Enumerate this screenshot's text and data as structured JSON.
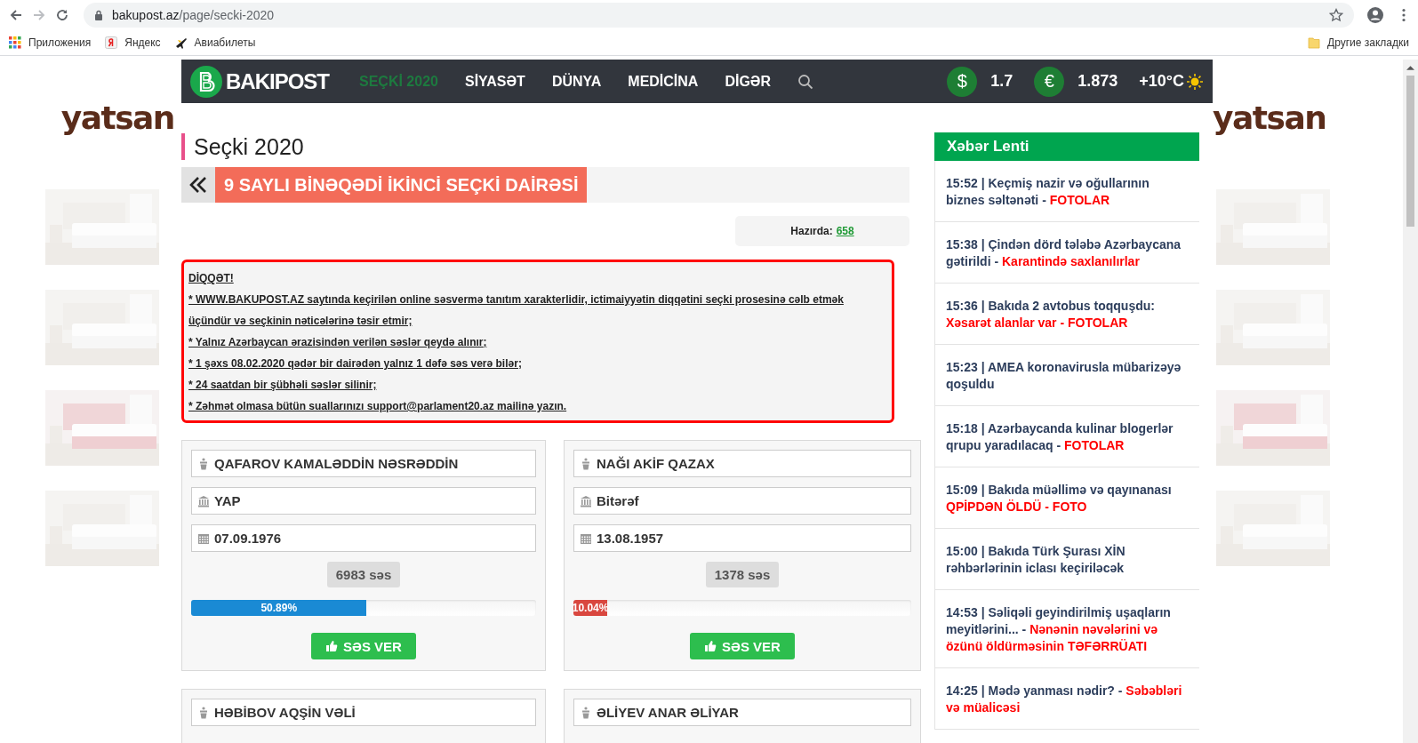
{
  "browser": {
    "url_host": "bakupost.az",
    "url_path": "/page/secki-2020",
    "bookmarks": [
      {
        "kind": "apps",
        "label": "Приложения"
      },
      {
        "kind": "yandex",
        "label": "Яндекс"
      },
      {
        "kind": "plane",
        "label": "Авиабилеты"
      }
    ],
    "other_bookmarks": "Другие закладки"
  },
  "nav": {
    "logo": "BAKIPOST",
    "items": [
      {
        "label": "SEÇKİ 2020",
        "selected": true
      },
      {
        "label": "SİYASƏT",
        "selected": false
      },
      {
        "label": "DÜNYA",
        "selected": false
      },
      {
        "label": "MEDİCİNA",
        "selected": false
      },
      {
        "label": "DİGƏR",
        "selected": false
      }
    ],
    "rates": [
      {
        "symbol": "$",
        "value": "1.7"
      },
      {
        "symbol": "€",
        "value": "1.873"
      }
    ],
    "weather": "+10°C"
  },
  "ads": {
    "left_brand": "yatsan",
    "right_brand": "yatsan"
  },
  "section_title": "Seçki 2020",
  "heading": "9 SAYLI BİNƏQƏDİ İKİNCİ SEÇKİ DAİRƏSİ",
  "online": {
    "label": "Hazırda:",
    "value": "658"
  },
  "notice": {
    "title": "DİQQƏT!",
    "lines": [
      "* WWW.BAKUPOST.AZ saytında keçirilən online səsvermə tanıtım xarakterlidir, ictimaiyyətin diqqətini seçki prosesinə cəlb etmək üçündür və seçkinin nəticələrinə təsir etmir;",
      "* Yalnız Azərbaycan ərazisindən verilən səslər qeydə alınır;",
      "* 1 şəxs 08.02.2020 qədər bir dairədən yalnız 1 dəfə səs verə bilər;",
      "* 24 saatdan bir şübhəli səslər silinir;",
      "* Zəhmət olmasa bütün suallarınızı support@parlament20.az mailinə yazın."
    ]
  },
  "candidates": [
    {
      "fields": [
        {
          "kind": "name",
          "text": "QAFAROV KAMALƏDDİN NƏSRƏDDİN"
        },
        {
          "kind": "party",
          "text": "YAP"
        },
        {
          "kind": "birth",
          "text": "07.09.1976"
        }
      ],
      "votes": "6983 səs",
      "level": 0.5089,
      "percent": "50.89%",
      "color": "#1a8ad4",
      "button": "SƏS VER"
    },
    {
      "fields": [
        {
          "kind": "name",
          "text": "NAĞI AKİF QAZAX"
        },
        {
          "kind": "party",
          "text": "Bitərəf"
        },
        {
          "kind": "birth",
          "text": "13.08.1957"
        }
      ],
      "votes": "1378 səs",
      "level": 0.1004,
      "percent": "10.04%",
      "color": "#d9473f",
      "button": "SƏS VER"
    },
    {
      "fields": [
        {
          "kind": "name",
          "text": "HƏBİBOV AQŞİN VƏLİ"
        }
      ]
    },
    {
      "fields": [
        {
          "kind": "name",
          "text": "ƏLİYEV ANAR ƏLİYAR"
        }
      ]
    }
  ],
  "news": {
    "title": "Xəbər Lenti",
    "items": [
      {
        "text": "15:52 | Keçmiş nazir və oğullarının biznes səltənəti - ",
        "tag": "FOTOLAR"
      },
      {
        "text": "15:38 | Çindən dörd tələbə Azərbaycana gətirildi - ",
        "tag": "Karantində saxlanılırlar"
      },
      {
        "text": "15:36 | Bakıda 2 avtobus toqquşdu: ",
        "tag": "Xəsarət alanlar var - FOTOLAR"
      },
      {
        "text": "15:23 | AMEA koronavirusla mübarizəyə qoşuldu"
      },
      {
        "text": "15:18 | Azərbaycanda kulinar blogerlər qrupu yaradılacaq - ",
        "tag": "FOTOLAR"
      },
      {
        "text": "15:09 | Bakıda müəllimə və qayınanası ",
        "tag": "QPİPDƏN ÖLDÜ - FOTO"
      },
      {
        "text": "15:00 | Bakıda Türk Şurası XİN rəhbərlərinin iclası keçiriləcək"
      },
      {
        "text": "14:53 | Səliqəli geyindirilmiş uşaqların meyitlərini... - ",
        "tag": "Nənənin nəvələrini və özünü öldürməsinin TƏFƏRRÜATI"
      },
      {
        "text": "14:25 | Mədə yanması nədir? - ",
        "tag": "Səbəbləri və müalicəsi"
      }
    ]
  }
}
